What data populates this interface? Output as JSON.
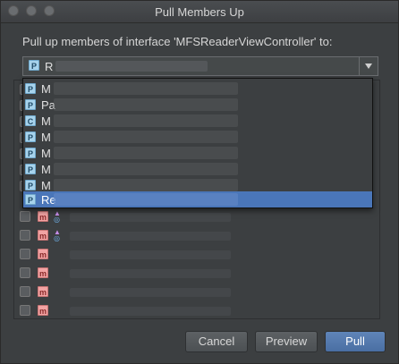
{
  "window": {
    "title": "Pull Members Up"
  },
  "dialog": {
    "prompt": "Pull up members of interface 'MFSReaderViewController' to:",
    "target_combo": {
      "badge": "P",
      "value": "R"
    }
  },
  "dropdown": {
    "items": [
      {
        "badge": "P",
        "text": "M"
      },
      {
        "badge": "P",
        "text": "Pa"
      },
      {
        "badge": "C",
        "text": "M"
      },
      {
        "badge": "P",
        "text": "M"
      },
      {
        "badge": "P",
        "text": "M"
      },
      {
        "badge": "P",
        "text": "M"
      },
      {
        "badge": "P",
        "text": "M"
      },
      {
        "badge": "P",
        "text": "Re"
      }
    ],
    "selected_index": 7
  },
  "members": {
    "rows": [
      {
        "badge": "m",
        "override": true
      },
      {
        "badge": "m",
        "override": true
      },
      {
        "badge": "m",
        "override": false
      },
      {
        "badge": "m",
        "override": false
      },
      {
        "badge": "m",
        "override": false
      },
      {
        "badge": "m",
        "override": false
      }
    ]
  },
  "buttons": {
    "cancel": "Cancel",
    "preview": "Preview",
    "pull": "Pull"
  }
}
